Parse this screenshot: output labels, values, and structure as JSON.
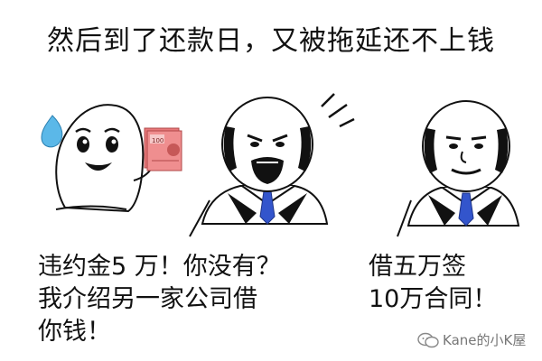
{
  "title": "然后到了还款日，又被拖延还不上钱",
  "captions": {
    "left_line1": "违约金5 万！你没有？",
    "left_line2": "我介绍另一家公司借",
    "left_line3": "你钱！",
    "right_line1": "借五万签",
    "right_line2": "10万合同！"
  },
  "banknote": {
    "denomination": "100"
  },
  "watermark": {
    "text": "Kane的小K屋"
  },
  "colors": {
    "tie": "#3355cc",
    "sweat_drop": "#5bb8e8",
    "banknote": "#e8787a",
    "outline": "#111111"
  },
  "icons": [
    "sweat-drop-icon",
    "wechat-watermark-icon"
  ]
}
